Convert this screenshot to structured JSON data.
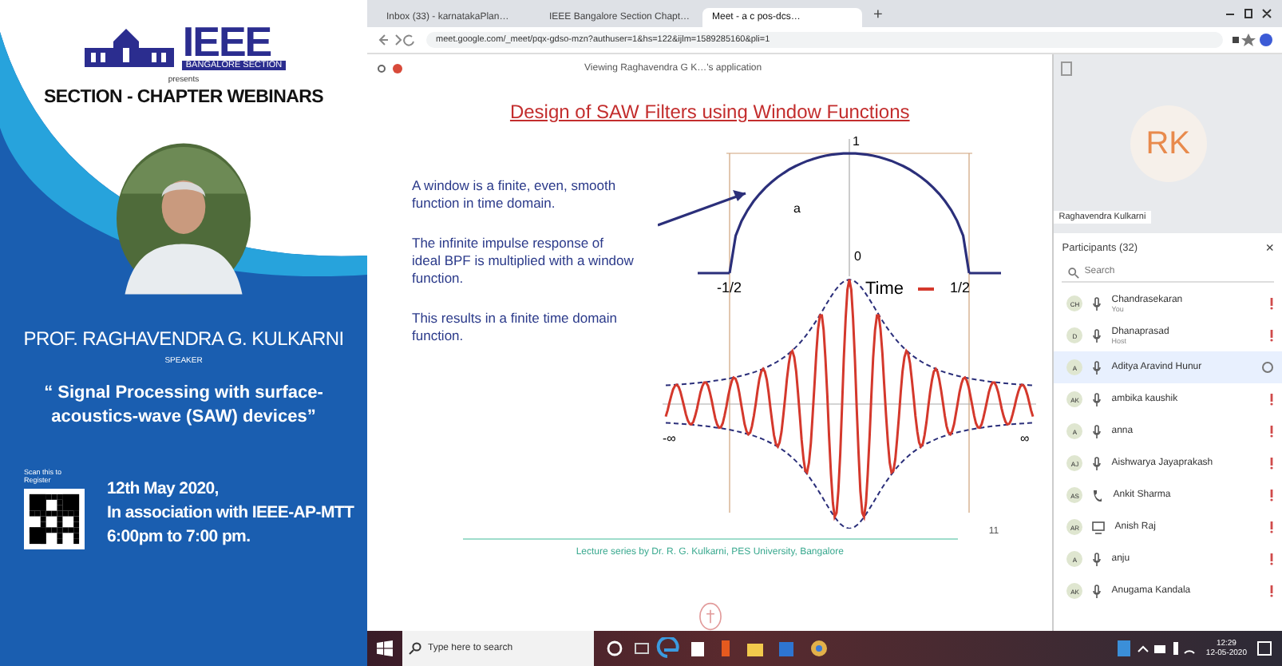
{
  "poster": {
    "org": "IEEE",
    "section": "BANGALORE SECTION",
    "presents": "presents",
    "series": "SECTION - CHAPTER WEBINARS",
    "speaker_name": "PROF.  RAGHAVENDRA G. KULKARNI",
    "speaker_role": "SPEAKER",
    "talk_title": "“ Signal Processing with surface-acoustics-wave (SAW) devices”",
    "scan_label": "Scan this to Register",
    "date": "12th May 2020,",
    "association": "In association with IEEE-AP-MTT",
    "time": "6:00pm to 7:00 pm."
  },
  "browser": {
    "tabs": [
      {
        "label": "Inbox (33) - karnatakaPlan…",
        "selected": false
      },
      {
        "label": "IEEE Bangalore Section Chapt…",
        "selected": false
      },
      {
        "label": "Meet - a c pos-dcs…",
        "selected": true
      }
    ],
    "new_tab": "+",
    "address": "meet.google.com/_meet/pqx-gdso-mzn?authuser=1&hs=122&ijlm=1589285160&pli=1"
  },
  "presentation": {
    "viewing": "Viewing Raghavendra G K…'s application",
    "title": "Design of SAW Filters using Window Functions",
    "paragraphs": [
      "A window is a finite, even, smooth function in time domain.",
      "The infinite impulse response of ideal BPF is multiplied with a window function.",
      "This results in a finite time domain function."
    ],
    "diagram_labels": [
      "1",
      "a",
      "0",
      "-1/2",
      "Time",
      "1/2",
      "-∞",
      "∞"
    ],
    "footer": "Lecture series by Dr. R. G. Kulkarni, PES University, Bangalore",
    "page": "11"
  },
  "meeting": {
    "presenter_initials": "RK",
    "presenter_name": "Raghavendra Kulkarni",
    "participants_title": "Participants (32)",
    "close": "×",
    "search_placeholder": "Search",
    "participants": [
      {
        "initials": "CH",
        "name": "Chandrasekaran",
        "note": "You",
        "kind": "mic",
        "selected": false
      },
      {
        "initials": "D",
        "name": "Dhanaprasad",
        "note": "Host",
        "kind": "mic",
        "selected": false
      },
      {
        "initials": "A",
        "name": "Aditya Aravind Hunur",
        "kind": "mic",
        "selected": true
      },
      {
        "initials": "AK",
        "name": "ambika kaushik",
        "kind": "mic",
        "selected": false
      },
      {
        "initials": "A",
        "name": "anna",
        "kind": "mic",
        "selected": false
      },
      {
        "initials": "AJ",
        "name": "Aishwarya Jayaprakash",
        "kind": "mic",
        "selected": false
      },
      {
        "initials": "AS",
        "name": "Ankit Sharma",
        "kind": "phone",
        "selected": false
      },
      {
        "initials": "AR",
        "name": "Anish Raj",
        "kind": "screen",
        "selected": false
      },
      {
        "initials": "A",
        "name": "anju",
        "kind": "mic",
        "selected": false
      },
      {
        "initials": "AK",
        "name": "Anugama Kandala",
        "kind": "mic",
        "selected": false
      }
    ]
  },
  "taskbar": {
    "search_placeholder": "Type here to search",
    "time": "12:29",
    "date": "12-05-2020"
  }
}
